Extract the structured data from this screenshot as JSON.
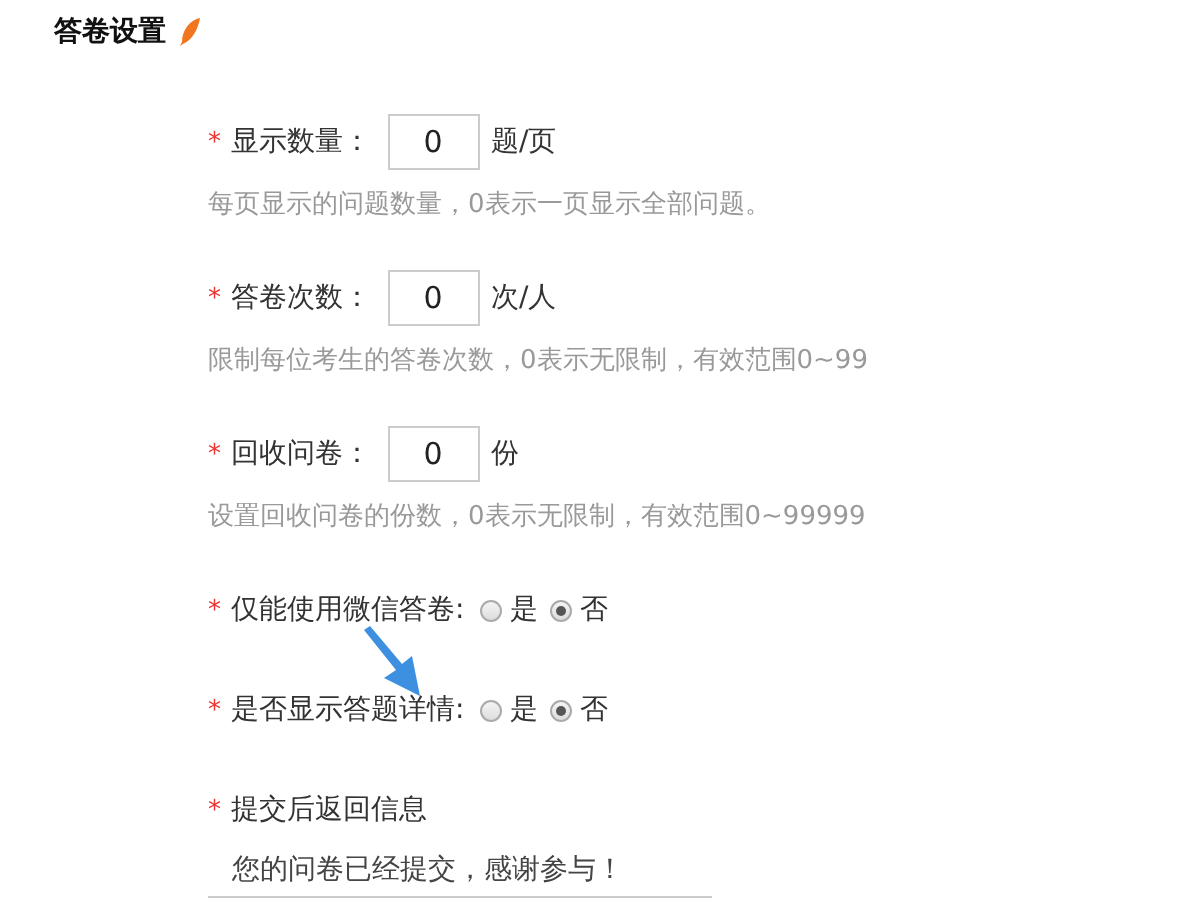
{
  "section": {
    "title": "答卷设置"
  },
  "fields": [
    {
      "kind": "number",
      "required": "*",
      "label": "显示数量：",
      "value": "0",
      "unit": "题/页",
      "hint": "每页显示的问题数量，0表示一页显示全部问题。"
    },
    {
      "kind": "number",
      "required": "*",
      "label": "答卷次数：",
      "value": "0",
      "unit": "次/人",
      "hint": "限制每位考生的答卷次数，0表示无限制，有效范围0~99"
    },
    {
      "kind": "number",
      "required": "*",
      "label": "回收问卷：",
      "value": "0",
      "unit": "份",
      "hint": "设置回收问卷的份数，0表示无限制，有效范围0~99999"
    },
    {
      "kind": "radio",
      "required": "*",
      "label": "仅能使用微信答卷:",
      "options": [
        {
          "label": "是",
          "selected": false
        },
        {
          "label": "否",
          "selected": true
        }
      ]
    },
    {
      "kind": "radio",
      "required": "*",
      "label": "是否显示答题详情:",
      "options": [
        {
          "label": "是",
          "selected": false
        },
        {
          "label": "否",
          "selected": true
        }
      ]
    },
    {
      "kind": "text",
      "required": "*",
      "label": "提交后返回信息",
      "value": "您的问卷已经提交，感谢参与！"
    }
  ]
}
